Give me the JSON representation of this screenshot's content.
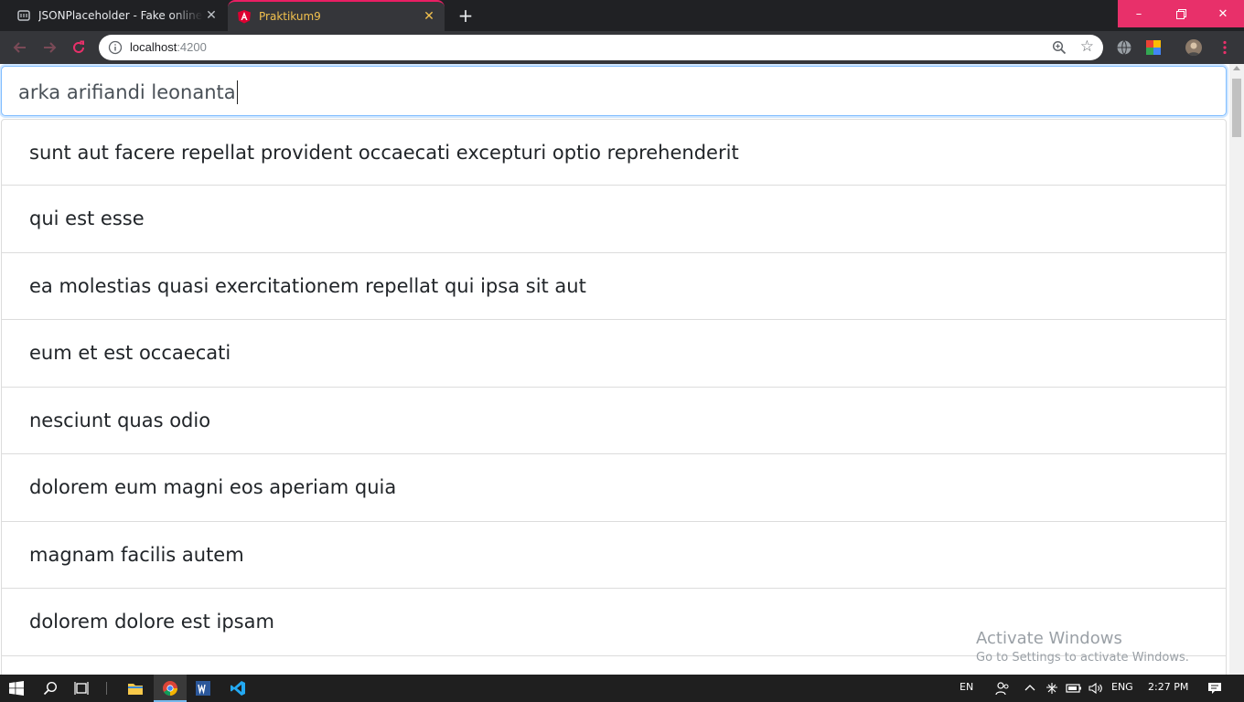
{
  "browser": {
    "tabs": [
      {
        "title": "JSONPlaceholder - Fake online REST API",
        "icon": "jsonplaceholder-icon"
      },
      {
        "title": "Praktikum9",
        "icon": "angular-icon",
        "active": true
      }
    ],
    "address": {
      "host": "localhost",
      "port": ":4200"
    }
  },
  "search": {
    "value": "arka arifiandi leonanta"
  },
  "posts": [
    "sunt aut facere repellat provident occaecati excepturi optio reprehenderit",
    "qui est esse",
    "ea molestias quasi exercitationem repellat qui ipsa sit aut",
    "eum et est occaecati",
    "nesciunt quas odio",
    "dolorem eum magni eos aperiam quia",
    "magnam facilis autem",
    "dolorem dolore est ipsam"
  ],
  "watermark": {
    "line1": "Activate Windows",
    "line2": "Go to Settings to activate Windows."
  },
  "taskbar": {
    "lang": "EN",
    "input": "ENG",
    "time": "2:27 PM"
  },
  "colors": {
    "accent": "#e8306a",
    "active_tab_text": "#f2c14e",
    "focus_border": "#80bdff"
  }
}
